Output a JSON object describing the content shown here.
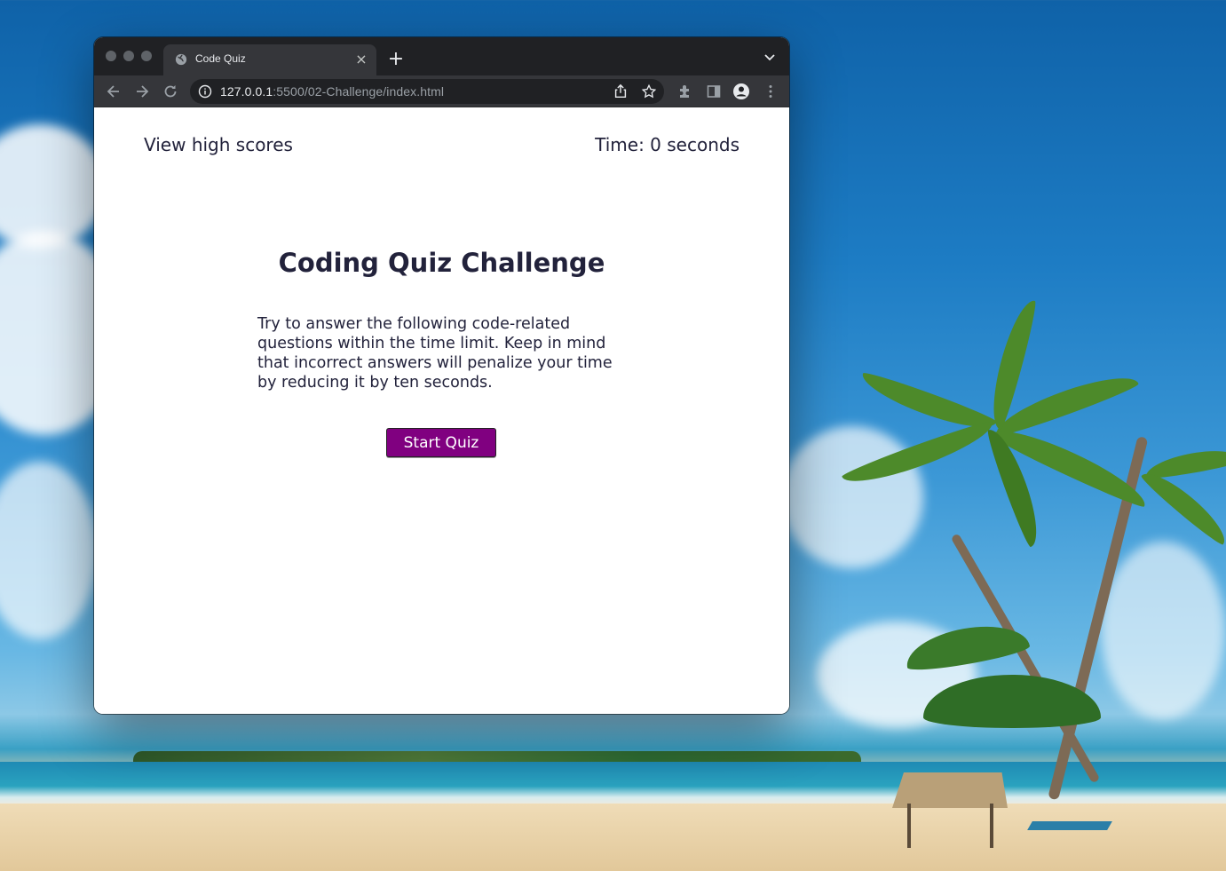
{
  "browser": {
    "tab_title": "Code Quiz",
    "new_tab_label": "+",
    "close_tab_label": "×",
    "url_host": "127.0.0.1",
    "url_rest": ":5500/02-Challenge/index.html"
  },
  "page": {
    "high_scores_link": "View high scores",
    "timer_text": "Time: 0 seconds",
    "title": "Coding Quiz Challenge",
    "intro": "Try to answer the following code-related questions within the time limit. Keep in mind that incorrect answers will penalize your time by reducing it by ten seconds.",
    "start_button": "Start Quiz"
  },
  "colors": {
    "accent": "#800080",
    "text": "#22223b",
    "browser_frame": "#35363a"
  },
  "icons": [
    "globe-icon",
    "close-icon",
    "plus-icon",
    "chevron-down-icon",
    "back-arrow-icon",
    "forward-arrow-icon",
    "reload-icon",
    "info-icon",
    "share-icon",
    "star-icon",
    "extensions-icon",
    "side-panel-icon",
    "profile-icon",
    "more-vert-icon"
  ]
}
